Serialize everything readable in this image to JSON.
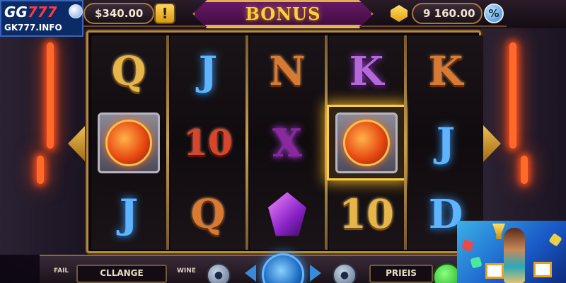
{
  "brand": {
    "logo_gg": "GG",
    "logo_num": "777",
    "url": "GK777.INFO"
  },
  "topbar": {
    "balance": "$340.00",
    "alert_icon": "!",
    "title": "BONUS",
    "coins": "9 160.00",
    "percent_icon": "%"
  },
  "reels": [
    [
      {
        "icon": "letter-q",
        "text": "Q",
        "style": "gold"
      },
      {
        "icon": "fire-badge-icon",
        "text": "",
        "style": "badge"
      },
      {
        "icon": "letter-j",
        "text": "J",
        "style": "blue"
      }
    ],
    [
      {
        "icon": "letter-j",
        "text": "J",
        "style": "blue"
      },
      {
        "icon": "number-10",
        "text": "10",
        "style": "red"
      },
      {
        "icon": "letter-q",
        "text": "Q",
        "style": "copper"
      }
    ],
    [
      {
        "icon": "letter-n",
        "text": "N",
        "style": "copper"
      },
      {
        "icon": "wild-x-icon",
        "text": "X",
        "style": "wild"
      },
      {
        "icon": "purple-crystal-icon",
        "text": "",
        "style": "crystal"
      }
    ],
    [
      {
        "icon": "letter-k",
        "text": "K",
        "style": "purple"
      },
      {
        "icon": "fire-badge-icon",
        "text": "",
        "style": "badge-winning"
      },
      {
        "icon": "number-10",
        "text": "10",
        "style": "gold"
      }
    ],
    [
      {
        "icon": "letter-k",
        "text": "K",
        "style": "copper"
      },
      {
        "icon": "letter-j",
        "text": "J",
        "style": "blue"
      },
      {
        "icon": "letter-d",
        "text": "D",
        "style": "blue"
      }
    ]
  ],
  "controls": {
    "fail_label": "FAIL",
    "change_label": "CLLANGE",
    "wine_label": "WINE",
    "prieis_label": "PRIEIS"
  },
  "colors": {
    "accent_gold": "#e7b64a",
    "banner_purple": "#6d1a6a",
    "win_glow": "#ffcf3a"
  }
}
